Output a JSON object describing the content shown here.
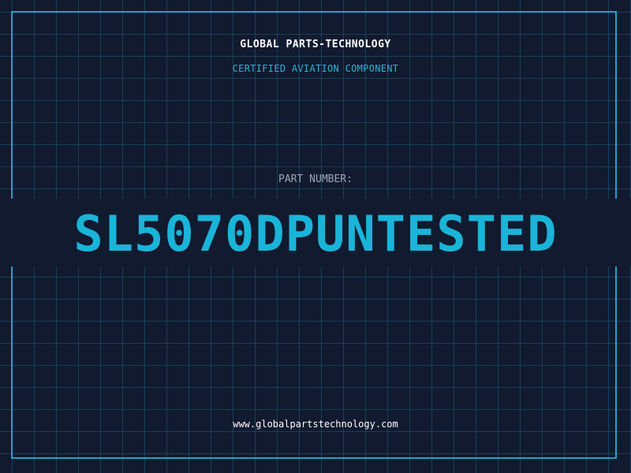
{
  "header": {
    "company": "GLOBAL PARTS-TECHNOLOGY",
    "subtitle": "CERTIFIED AVIATION COMPONENT"
  },
  "part": {
    "label": "PART NUMBER:",
    "number": "SL5070DPUNTESTED"
  },
  "footer": {
    "website": "www.globalpartstechnology.com"
  },
  "colors": {
    "background": "#111a2e",
    "grid": "#1e5f7d",
    "accent": "#1ab4d9",
    "frame": "#1fa3c9"
  }
}
